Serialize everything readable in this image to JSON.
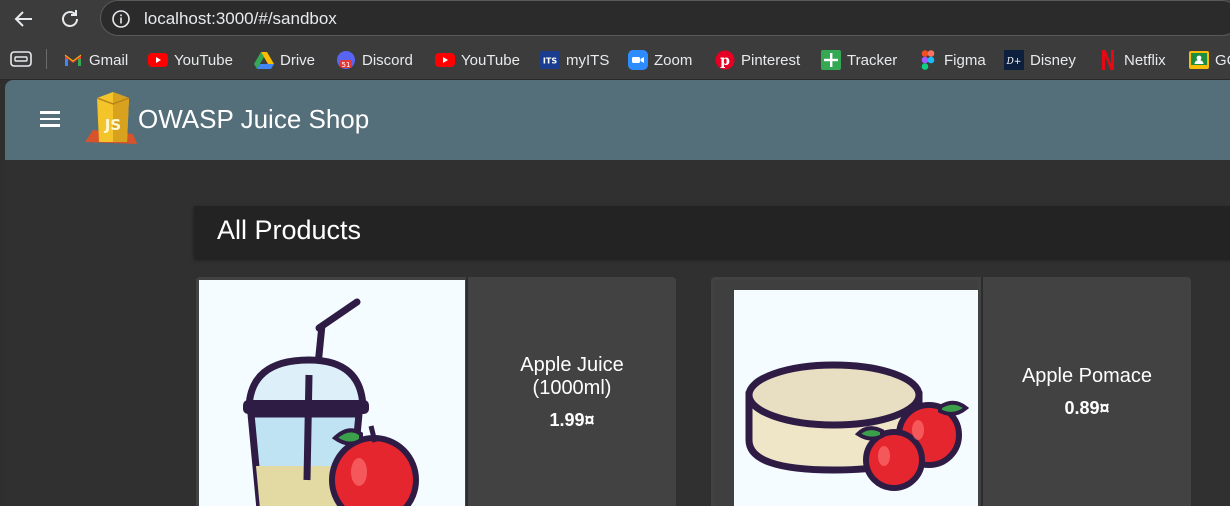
{
  "browser": {
    "url": "localhost:3000/#/sandbox",
    "bookmarks": [
      {
        "label": "Gmail",
        "icon": "gmail-icon"
      },
      {
        "label": "YouTube",
        "icon": "youtube-icon"
      },
      {
        "label": "Drive",
        "icon": "drive-icon"
      },
      {
        "label": "Discord",
        "icon": "discord-icon"
      },
      {
        "label": "YouTube",
        "icon": "youtube-icon"
      },
      {
        "label": "myITS",
        "icon": "myits-icon"
      },
      {
        "label": "Zoom",
        "icon": "zoom-icon"
      },
      {
        "label": "Pinterest",
        "icon": "pinterest-icon"
      },
      {
        "label": "Tracker",
        "icon": "tracker-icon"
      },
      {
        "label": "Figma",
        "icon": "figma-icon"
      },
      {
        "label": "Disney",
        "icon": "disney-icon"
      },
      {
        "label": "Netflix",
        "icon": "netflix-icon"
      },
      {
        "label": "GC",
        "icon": "classroom-icon"
      }
    ]
  },
  "app": {
    "title": "OWASP Juice Shop",
    "toolbar_color": "#546e7a"
  },
  "main": {
    "heading": "All Products",
    "products": [
      {
        "name_line1": "Apple Juice",
        "name_line2": "(1000ml)",
        "price": "1.99¤"
      },
      {
        "name_line1": "Apple Pomace",
        "name_line2": "",
        "price": "0.89¤"
      }
    ]
  }
}
